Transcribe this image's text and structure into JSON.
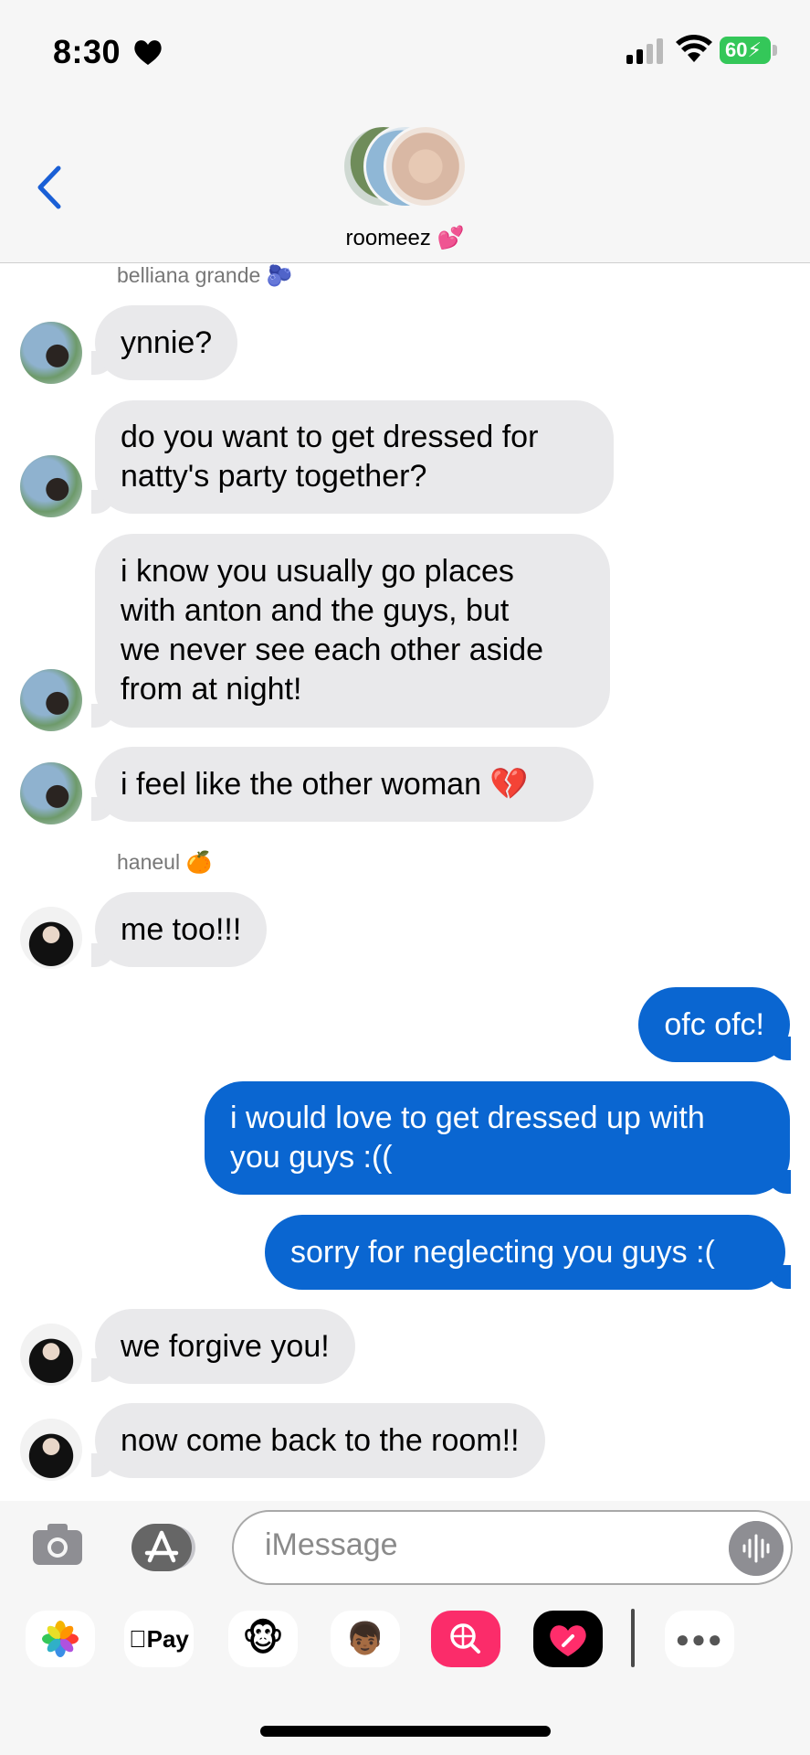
{
  "status_bar": {
    "time": "8:30",
    "battery": "60"
  },
  "conversation": {
    "group_name": "roomeez 💕"
  },
  "messages": [
    {
      "sender": "belliana grande 🫐"
    },
    {
      "text": "ynnie?"
    },
    {
      "text": "do you want to get dressed for\nnatty's party together?"
    },
    {
      "text": "i know you usually go places\nwith anton and the guys, but\nwe never see each other aside\nfrom at night!"
    },
    {
      "text": "i feel like the other woman 💔"
    },
    {
      "sender": "haneul 🍊"
    },
    {
      "text": "me too!!!"
    },
    {
      "text": "ofc ofc!"
    },
    {
      "text": "i would love to get dressed up with\nyou guys :(("
    },
    {
      "text": "sorry for neglecting you guys :("
    },
    {
      "text": "we forgive you!"
    },
    {
      "text": "now come back to the room!!"
    }
  ],
  "composer": {
    "placeholder": "iMessage"
  },
  "app_tray": {
    "apple_pay_label": "Pay"
  },
  "colors": {
    "outgoing_bubble": "#0a66d1",
    "incoming_bubble": "#e9e9eb",
    "accent": "#1a5fd6"
  }
}
